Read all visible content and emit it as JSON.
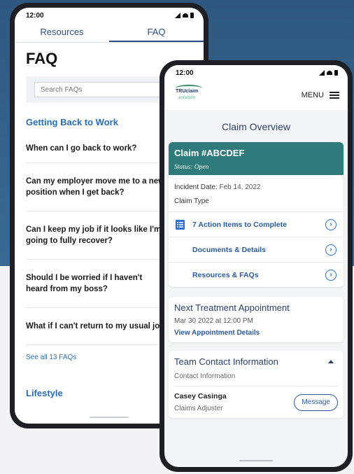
{
  "phone_faq": {
    "status_time": "12:00",
    "tabs": [
      {
        "label": "Resources"
      },
      {
        "label": "FAQ"
      }
    ],
    "title": "FAQ",
    "search_placeholder": "Search FAQs",
    "section_title": "Getting Back to Work",
    "questions": [
      {
        "text": "When can I go back to work?"
      },
      {
        "text": "Can my employer move me to a new position when I get back?"
      },
      {
        "text": "Can I keep my job if it looks like I'm never going to fully recover?"
      },
      {
        "text": "Should I be worried if I haven't heard from my boss?"
      },
      {
        "text": "What if I can't return to my usual job?"
      }
    ],
    "see_all": "See all 13 FAQs",
    "next_section": "Lifestyle"
  },
  "phone_claim": {
    "status_time": "12:00",
    "logo_text": "TRUclaim",
    "logo_sub": "solution",
    "menu_label": "MENU",
    "page_title": "Claim Overview",
    "claim": {
      "number": "Claim #ABCDEF",
      "status": "Status: Open",
      "incident_label": "Incident Date:",
      "incident_date": "Feb 14, 2022",
      "type_label": "Claim Type"
    },
    "actions": [
      {
        "label": "7 Action Items to Complete",
        "icon": "checklist-icon"
      },
      {
        "label": "Documents & Details",
        "icon": "document-icon"
      },
      {
        "label": "Resources & FAQs",
        "icon": "bookmark-icon"
      }
    ],
    "appointment": {
      "title": "Next Treatment Appointment",
      "date": "Mar 30 2022 at 12:00 PM",
      "link": "View Appointment Details"
    },
    "team": {
      "title": "Team Contact Information",
      "subtitle": "Contact Information",
      "contact_name": "Casey Casinga",
      "contact_role": "Claims Adjuster",
      "message_label": "Message"
    }
  },
  "colors": {
    "background_top": "#2f5a80",
    "claim_header": "#2f7a7a",
    "link_blue": "#2a5a9c",
    "heading_navy": "#2b4068"
  }
}
